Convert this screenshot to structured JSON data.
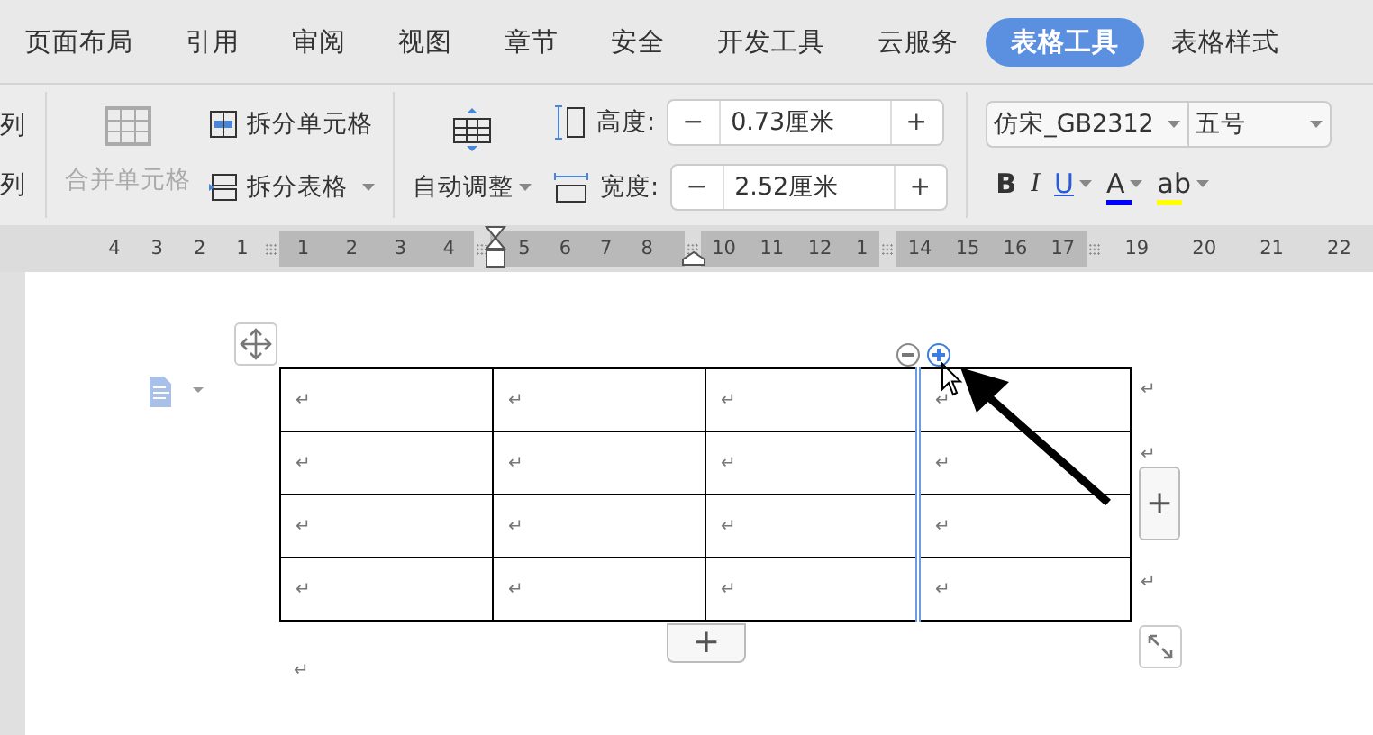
{
  "tabs": [
    {
      "label": "页面布局",
      "selected": false
    },
    {
      "label": "引用",
      "selected": false
    },
    {
      "label": "审阅",
      "selected": false
    },
    {
      "label": "视图",
      "selected": false
    },
    {
      "label": "章节",
      "selected": false
    },
    {
      "label": "安全",
      "selected": false
    },
    {
      "label": "开发工具",
      "selected": false
    },
    {
      "label": "云服务",
      "selected": false
    },
    {
      "label": "表格工具",
      "selected": true
    },
    {
      "label": "表格样式",
      "selected": false
    }
  ],
  "ribbon": {
    "partial_labels": [
      "列",
      "列"
    ],
    "merge_cells": {
      "label": "合并单元格",
      "disabled": true
    },
    "split_cells": {
      "label": "拆分单元格"
    },
    "split_table": {
      "label": "拆分表格"
    },
    "auto_fit": {
      "label": "自动调整"
    },
    "sizes": [
      {
        "kind": "height",
        "label": "高度:",
        "minus": "−",
        "value": "0.73厘米",
        "plus": "+"
      },
      {
        "kind": "width",
        "label": "宽度:",
        "minus": "−",
        "value": "2.52厘米",
        "plus": "+"
      }
    ],
    "font": {
      "family": "仿宋_GB2312",
      "size": "五号"
    },
    "format_buttons": [
      {
        "kind": "bold",
        "label": "B",
        "dropdown": false
      },
      {
        "kind": "italic",
        "label": "I",
        "dropdown": false
      },
      {
        "kind": "underline",
        "label": "U",
        "dropdown": true
      },
      {
        "kind": "font_color",
        "label": "A",
        "dropdown": true,
        "color": "#0000ff"
      },
      {
        "kind": "highlight",
        "label": "ab",
        "dropdown": true,
        "color": "#ffff00"
      }
    ]
  },
  "ruler": {
    "segments": [
      {
        "shaded": false,
        "numbers": [
          "4",
          "3",
          "2",
          "1"
        ]
      },
      {
        "shaded": true,
        "numbers": [
          "1",
          "2",
          "3",
          "4"
        ]
      },
      {
        "shaded": true,
        "numbers": [
          "5",
          "6",
          "7",
          "8"
        ]
      },
      {
        "shaded": true,
        "numbers": [
          "10",
          "11",
          "12",
          "1"
        ]
      },
      {
        "shaded": true,
        "numbers": [
          "14",
          "15",
          "16",
          "17"
        ]
      },
      {
        "shaded": false,
        "numbers": [
          "19",
          "20",
          "21",
          "22"
        ]
      }
    ]
  },
  "document": {
    "table": {
      "rows": [
        {
          "cells": [
            "↵",
            "↵",
            "↵",
            "↵"
          ],
          "end_mark": "↵"
        },
        {
          "cells": [
            "↵",
            "↵",
            "↵",
            "↵"
          ],
          "end_mark": "↵"
        },
        {
          "cells": [
            "↵",
            "↵",
            "↵",
            "↵"
          ]
        },
        {
          "cells": [
            "↵",
            "↵",
            "↵",
            "↵"
          ],
          "end_mark": "↵"
        }
      ]
    },
    "trailing_mark": "↵",
    "add_row_button": "+",
    "add_column_button": "+"
  }
}
